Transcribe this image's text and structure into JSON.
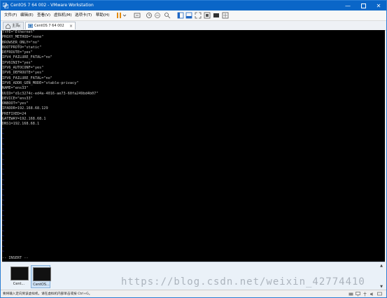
{
  "window": {
    "title": "CentOS 7 64 002 - VMware Workstation"
  },
  "menu": {
    "items": [
      "文件(F)",
      "编辑(E)",
      "查看(V)",
      "虚拟机(M)",
      "选项卡(T)",
      "帮助(H)"
    ]
  },
  "tabs": [
    {
      "label": "主页"
    },
    {
      "label": "CentOS 7 64 002"
    }
  ],
  "console": {
    "lines": [
      "TYPE=\"Ethernet\"",
      "PROXY_METHOD=\"none\"",
      "BROWSER_ONLY=\"no\"",
      "BOOTPROTO=\"static\"",
      "DEFROUTE=\"yes\"",
      "IPV4_FAILURE_FATAL=\"no\"",
      "IPV6INIT=\"yes\"",
      "IPV6_AUTOCONF=\"yes\"",
      "IPV6_DEFROUTE=\"yes\"",
      "IPV6_FAILURE_FATAL=\"no\"",
      "IPV6_ADDR_GEN_MODE=\"stable-privacy\"",
      "NAME=\"ens33\"",
      "UUID=\"d1c3274c-ed4a-4016-ae73-60fa249bd4b07\"",
      "DEVICE=\"ens33\"",
      "ONBOOT=\"yes\"",
      "IPADDR=192.168.68.129",
      "PREFIXED=24",
      "GATEWAY=192.168.68.1",
      "DNS1=192.168.68.1"
    ],
    "tilde": "~",
    "mode": "-- INSERT --"
  },
  "thumbnails": [
    {
      "label": "Cent..."
    },
    {
      "label": "CentOS..."
    }
  ],
  "watermark": "https://blog.csdn.net/weixin_42774410",
  "status": {
    "text": "要将输入定向到该虚拟机，请在虚拟机内部单击或按 Ctrl+G。"
  }
}
